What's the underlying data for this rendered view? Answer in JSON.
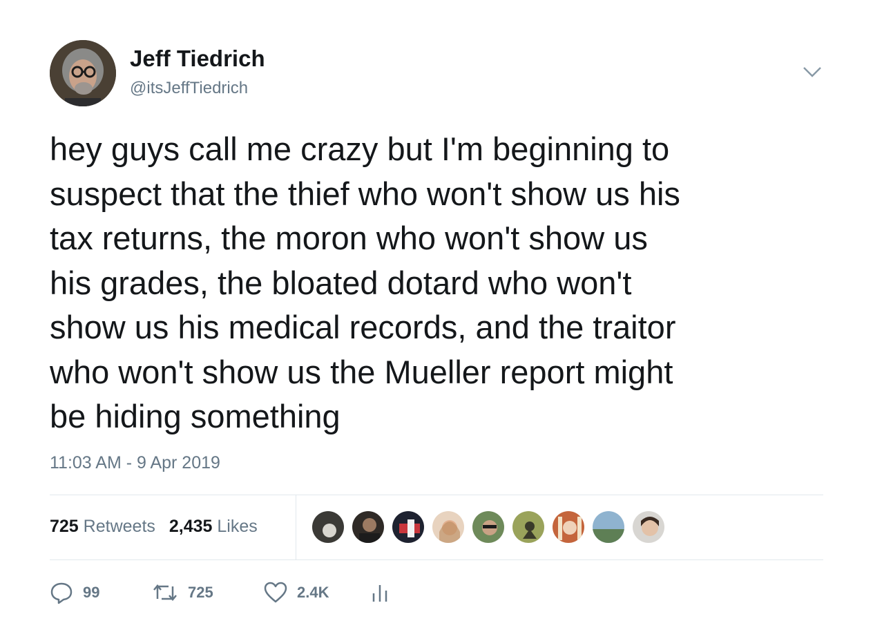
{
  "user": {
    "display_name": "Jeff Tiedrich",
    "handle": "@itsJeffTiedrich"
  },
  "tweet": {
    "text": "hey guys call me crazy but I'm beginning to\nsuspect that the thief who won't show us his\ntax returns, the moron who won't show us\nhis grades, the bloated dotard who won't\nshow us his medical records, and the traitor\nwho won't show us the Mueller report might\nbe hiding something",
    "timestamp": "11:03 AM - 9 Apr 2019"
  },
  "stats": {
    "retweets_count": "725",
    "retweets_label": "Retweets",
    "likes_count": "2,435",
    "likes_label": "Likes"
  },
  "actions": {
    "replies": "99",
    "retweets": "725",
    "likes": "2.4K"
  },
  "icons": {
    "caret": "chevron-down-icon",
    "reply": "reply-icon",
    "retweet": "retweet-icon",
    "like": "heart-icon",
    "analytics": "analytics-icon"
  },
  "colors": {
    "text_primary": "#14171a",
    "text_secondary": "#657786",
    "divider": "#e1e8ed"
  }
}
